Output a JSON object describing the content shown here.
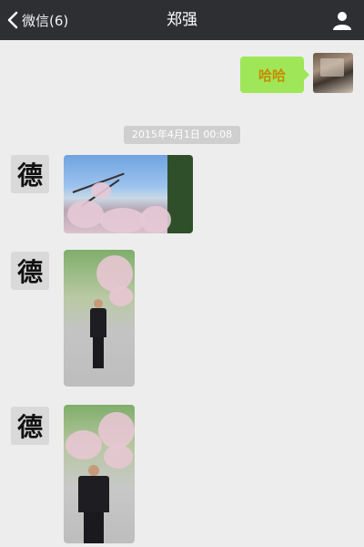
{
  "nav": {
    "back_label": "微信(6)",
    "title": "郑强",
    "icons": {
      "back": "chevron-left-icon",
      "profile": "person-icon"
    }
  },
  "messages": [
    {
      "sender": "self",
      "type": "text",
      "text": "哈哈"
    },
    {
      "type": "timestamp",
      "text": "2015年4月1日 00:08"
    },
    {
      "sender": "contact",
      "avatar_char": "德",
      "type": "image",
      "description": "photo"
    },
    {
      "sender": "contact",
      "avatar_char": "德",
      "type": "image",
      "description": "photo"
    },
    {
      "sender": "contact",
      "avatar_char": "德",
      "type": "image",
      "description": "photo"
    }
  ],
  "colors": {
    "nav_bg": "#2e2f33",
    "chat_bg": "#ededed",
    "bubble_self": "#9fe658"
  }
}
